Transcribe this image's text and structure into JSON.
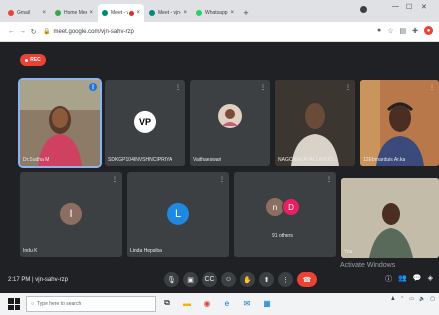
{
  "browser": {
    "tabs": [
      {
        "label": "Gmail",
        "favicon_color": "#ea4335"
      },
      {
        "label": "Home Meeting",
        "favicon_color": "#34a853"
      },
      {
        "label": "Meet - vjn-sa",
        "favicon_color": "#00897b",
        "active": true
      },
      {
        "label": "Meet - vjn-sahv",
        "favicon_color": "#00897b"
      },
      {
        "label": "Whatsapp",
        "favicon_color": "#25d366"
      }
    ],
    "new_tab": "+",
    "url": "meet.google.com/vjn-sahv-rzp"
  },
  "meet": {
    "rec_label": "REC",
    "tiles": [
      {
        "name": "Dr.Sudha M",
        "type": "photo"
      },
      {
        "name": "SDKGP104INVSHNCIPRIYA",
        "type": "logo",
        "logo_text": "VP"
      },
      {
        "name": "Vaithaeswari",
        "type": "photo"
      },
      {
        "name": "NAGCNIALAYALLAHOD...",
        "type": "photo"
      },
      {
        "name": "12Ebrnarduis Ar.ka",
        "type": "photo"
      },
      {
        "name": "Indu K",
        "type": "letter",
        "letter": "I",
        "color": "#8d6e63"
      },
      {
        "name": "Linda Hepsiba",
        "type": "letter",
        "letter": "L",
        "color": "#1e88e5"
      },
      {
        "name": "91 others",
        "type": "multi",
        "letters": [
          "n",
          "D"
        ],
        "colors": [
          "#8d6e63",
          "#e91e63"
        ]
      },
      {
        "name": "You",
        "type": "photo"
      }
    ],
    "time": "2:17 PM",
    "meeting_code": "vjn-sahv-rzp",
    "watermark": "Activate Windows"
  },
  "taskbar": {
    "search_placeholder": "Type here to search"
  }
}
